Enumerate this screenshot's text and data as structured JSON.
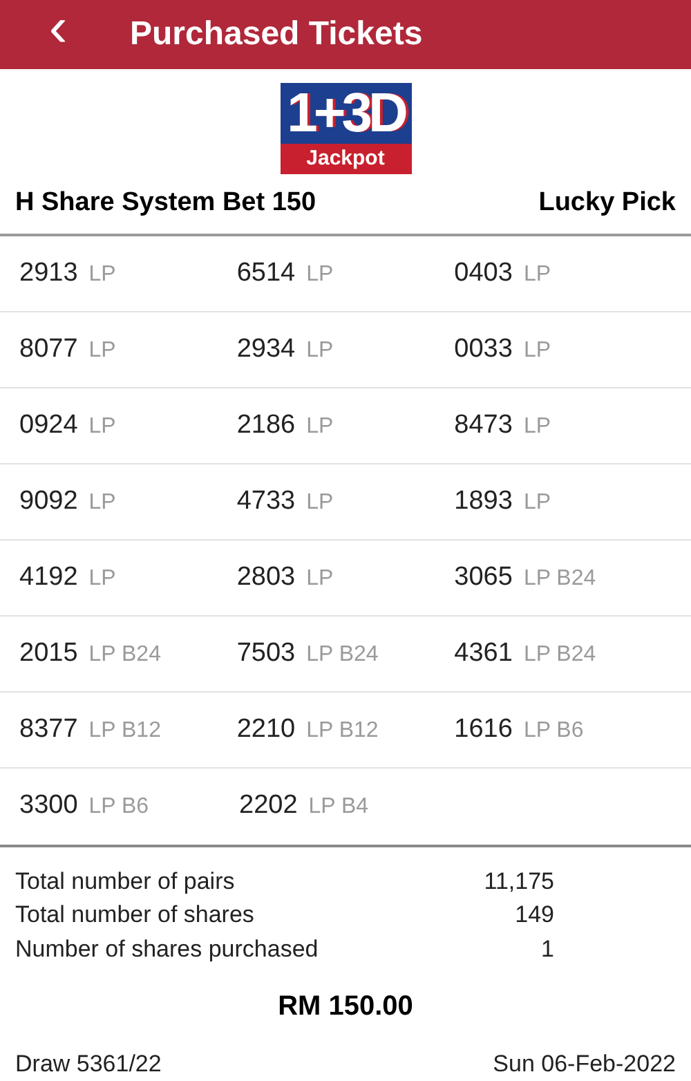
{
  "header": {
    "back_icon": "‹",
    "title": "Purchased Tickets"
  },
  "logo": {
    "main": "1+3D",
    "sub": "Jackpot"
  },
  "bet": {
    "type": "H Share System Bet 150",
    "pick": "Lucky Pick"
  },
  "tickets": [
    [
      {
        "number": "2913",
        "tags": "LP"
      },
      {
        "number": "6514",
        "tags": "LP"
      },
      {
        "number": "0403",
        "tags": "LP"
      }
    ],
    [
      {
        "number": "8077",
        "tags": "LP"
      },
      {
        "number": "2934",
        "tags": "LP"
      },
      {
        "number": "0033",
        "tags": "LP"
      }
    ],
    [
      {
        "number": "0924",
        "tags": "LP"
      },
      {
        "number": "2186",
        "tags": "LP"
      },
      {
        "number": "8473",
        "tags": "LP"
      }
    ],
    [
      {
        "number": "9092",
        "tags": "LP"
      },
      {
        "number": "4733",
        "tags": "LP"
      },
      {
        "number": "1893",
        "tags": "LP"
      }
    ],
    [
      {
        "number": "4192",
        "tags": "LP"
      },
      {
        "number": "2803",
        "tags": "LP"
      },
      {
        "number": "3065",
        "tags": "LP B24"
      }
    ],
    [
      {
        "number": "2015",
        "tags": "LP B24"
      },
      {
        "number": "7503",
        "tags": "LP B24"
      },
      {
        "number": "4361",
        "tags": "LP B24"
      }
    ],
    [
      {
        "number": "8377",
        "tags": "LP B12"
      },
      {
        "number": "2210",
        "tags": "LP B12"
      },
      {
        "number": "1616",
        "tags": "LP B6"
      }
    ],
    [
      {
        "number": "3300",
        "tags": "LP B6"
      },
      {
        "number": "2202",
        "tags": "LP B4"
      }
    ]
  ],
  "summary": [
    {
      "label": "Total number of pairs",
      "value": "11,175"
    },
    {
      "label": "Total number of shares",
      "value": "149"
    },
    {
      "label": "Number of shares purchased",
      "value": "1"
    }
  ],
  "amount": "RM 150.00",
  "footer": {
    "draw": "Draw 5361/22",
    "date": "Sun 06-Feb-2022"
  }
}
